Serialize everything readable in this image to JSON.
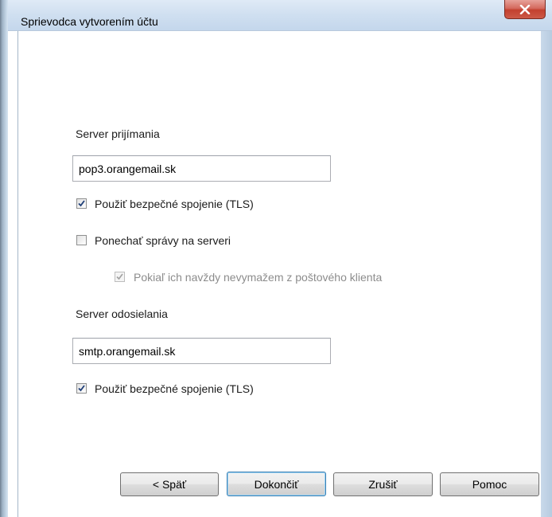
{
  "window": {
    "title": "Sprievodca vytvorením účtu",
    "close_label": "x"
  },
  "incoming": {
    "label": "Server prijímania",
    "server": "pop3.orangemail.sk",
    "tls_label": "Použiť bezpečné spojenie (TLS)",
    "tls_checked": true,
    "leave_label": "Ponechať správy na serveri",
    "leave_checked": false,
    "until_delete_label": "Pokiaľ ich navždy nevymažem z poštového klienta",
    "until_delete_checked": true,
    "until_delete_enabled": false
  },
  "outgoing": {
    "label": "Server odosielania",
    "server": "smtp.orangemail.sk",
    "tls_label": "Použiť bezpečné spojenie (TLS)",
    "tls_checked": true
  },
  "buttons": {
    "back": "< Späť",
    "finish": "Dokončiť",
    "cancel": "Zrušiť",
    "help": "Pomoc"
  },
  "colors": {
    "checkmark": "#1f3f78",
    "checkmark_disabled": "#a0a0a0",
    "close": "#c3402f"
  }
}
